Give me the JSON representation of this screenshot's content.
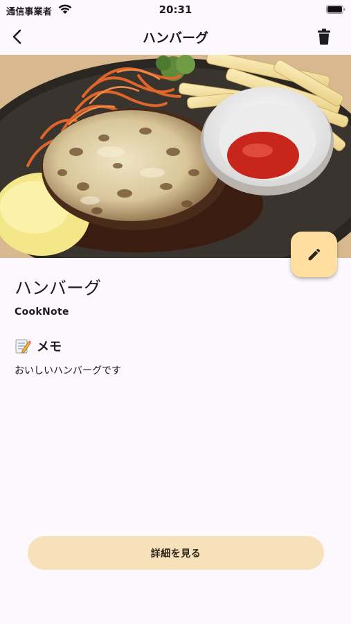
{
  "status_bar": {
    "carrier": "通信事業者",
    "time": "20:31"
  },
  "app_bar": {
    "title": "ハンバーグ",
    "back_icon": "chevron-left-icon",
    "delete_icon": "trash-icon"
  },
  "recipe": {
    "title": "ハンバーグ",
    "source": "CookNote",
    "memo_heading": "メモ",
    "memo_icon": "memo-icon",
    "memo_text": "おいしいハンバーグです"
  },
  "actions": {
    "edit_icon": "pencil-icon",
    "detail_label": "詳細を見る"
  },
  "colors": {
    "background": "#fcf8fd",
    "fab": "#ffdea0",
    "detail_button": "#f7e1ba"
  }
}
